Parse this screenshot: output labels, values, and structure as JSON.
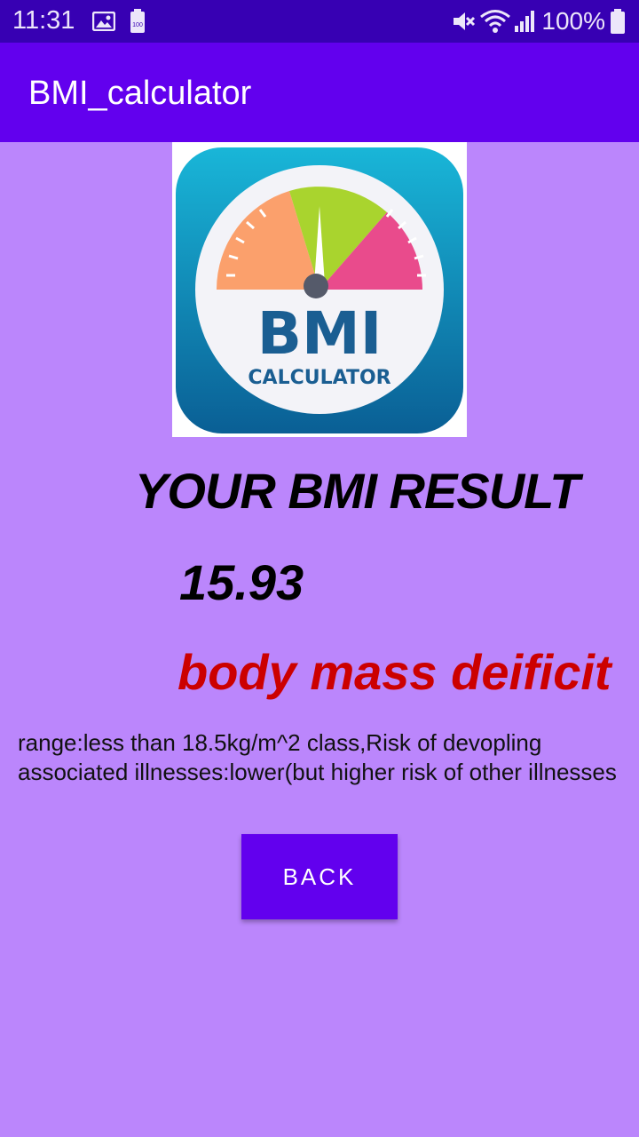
{
  "status_bar": {
    "time": "11:31",
    "battery_percent": "100%",
    "icons": [
      "image-icon",
      "battery-saver-icon",
      "mute-icon",
      "wifi-icon",
      "signal-icon",
      "battery-icon"
    ]
  },
  "app_bar": {
    "title": "BMI_calculator",
    "color": "#6200EE"
  },
  "logo": {
    "bmi_text": "BMI",
    "calculator_text": "CALCULATOR"
  },
  "result": {
    "heading": "YOUR BMI RESULT",
    "value": "15.93",
    "category": "body mass deificit",
    "category_color": "#CC0000",
    "description": "range:less than 18.5kg/m^2 class,Risk of devopling associated illnesses:lower(but higher risk of other illnesses"
  },
  "actions": {
    "back_label": "BACK"
  },
  "colors": {
    "background": "#BB86FC",
    "status_bar": "#3700B3",
    "primary": "#6200EE"
  }
}
